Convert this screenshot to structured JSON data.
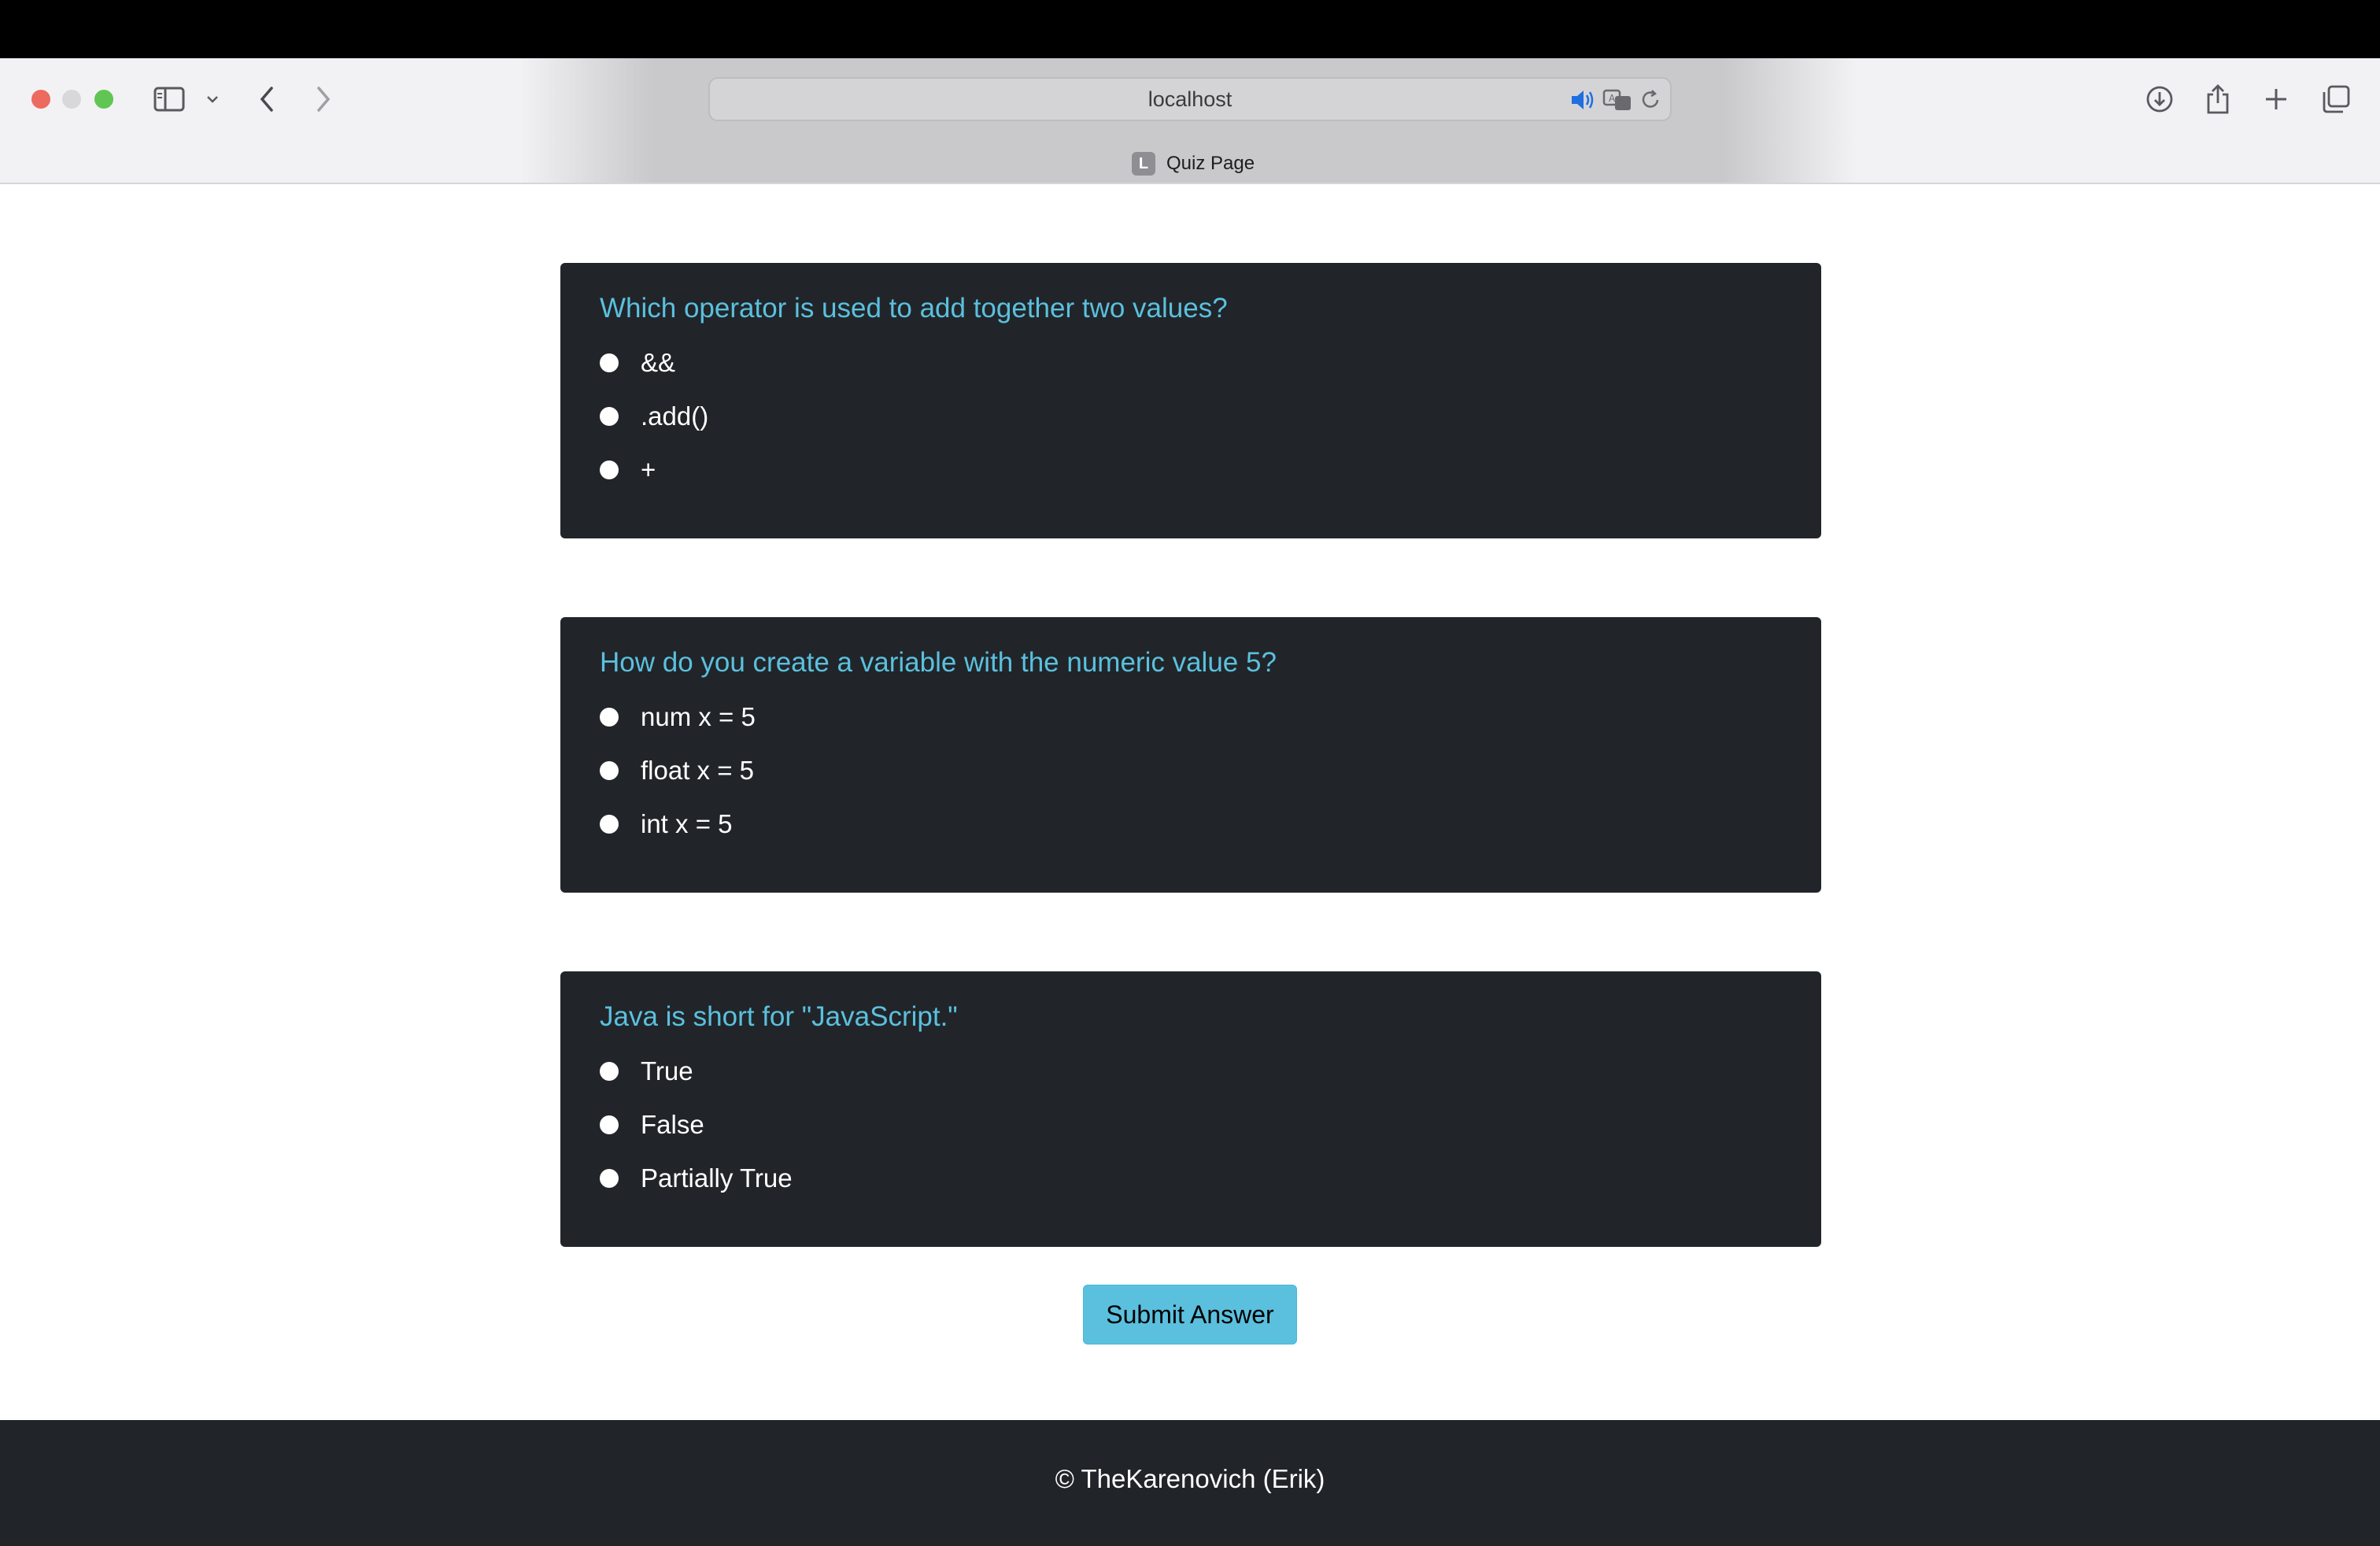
{
  "browser": {
    "url": "localhost",
    "tab_title": "Quiz Page",
    "tab_favicon_letter": "L"
  },
  "questions": [
    {
      "text": "Which operator is used to add together two values?",
      "options": [
        "&&",
        ".add()",
        "+"
      ]
    },
    {
      "text": "How do you create a variable with the numeric value 5?",
      "options": [
        "num x = 5",
        "float x = 5",
        "int x = 5"
      ]
    },
    {
      "text": "Java is short for \"JavaScript.\"",
      "options": [
        "True",
        "False",
        "Partially True"
      ]
    }
  ],
  "submit_label": "Submit Answer",
  "footer_text": "© TheKarenovich (Erik)",
  "colors": {
    "card_bg": "#212529",
    "question_text": "#5bc0de",
    "button_bg": "#5bc0de"
  }
}
